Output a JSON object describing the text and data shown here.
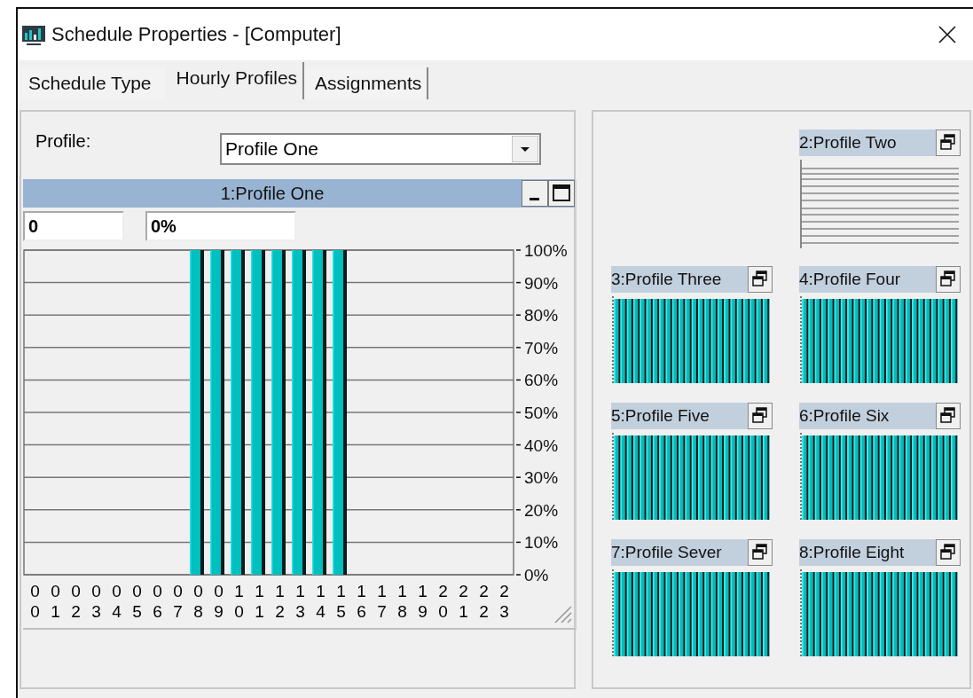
{
  "window": {
    "title": "Schedule Properties - [Computer]"
  },
  "tabs": [
    {
      "label": "Schedule Type",
      "selected": false
    },
    {
      "label": "Hourly Profiles",
      "selected": true
    },
    {
      "label": "Assignments",
      "selected": false
    }
  ],
  "profile_field": {
    "label": "Profile:",
    "value": "Profile One"
  },
  "profile_window": {
    "title": "1:Profile One",
    "hour_field": "0",
    "percent_field": "0%",
    "chart_data": {
      "type": "bar",
      "grid": true,
      "categories": [
        "00",
        "01",
        "02",
        "03",
        "04",
        "05",
        "06",
        "07",
        "08",
        "09",
        "10",
        "11",
        "12",
        "13",
        "14",
        "15",
        "16",
        "17",
        "18",
        "19",
        "20",
        "21",
        "22",
        "23"
      ],
      "values": [
        0,
        0,
        0,
        0,
        0,
        0,
        0,
        0,
        100,
        100,
        100,
        100,
        100,
        100,
        100,
        100,
        0,
        0,
        0,
        0,
        0,
        0,
        0,
        0
      ],
      "ylim": [
        0,
        100
      ],
      "yticks": [
        {
          "value": 100,
          "label": "100%"
        },
        {
          "value": 90,
          "label": "90%"
        },
        {
          "value": 80,
          "label": "80%"
        },
        {
          "value": 70,
          "label": "70%"
        },
        {
          "value": 60,
          "label": "60%"
        },
        {
          "value": 50,
          "label": "50%"
        },
        {
          "value": 40,
          "label": "40%"
        },
        {
          "value": 30,
          "label": "30%"
        },
        {
          "value": 20,
          "label": "20%"
        },
        {
          "value": 10,
          "label": "10%"
        },
        {
          "value": 0,
          "label": "0%"
        }
      ]
    }
  },
  "thumbnails": [
    {
      "title": "2:Profile Two",
      "kind": "empty"
    },
    {
      "title": "3:Profile Three",
      "kind": "full"
    },
    {
      "title": "4:Profile Four",
      "kind": "full"
    },
    {
      "title": "5:Profile Five",
      "kind": "full"
    },
    {
      "title": "6:Profile Six",
      "kind": "full"
    },
    {
      "title": "7:Profile Sever",
      "kind": "full"
    },
    {
      "title": "8:Profile Eight",
      "kind": "full"
    }
  ]
}
